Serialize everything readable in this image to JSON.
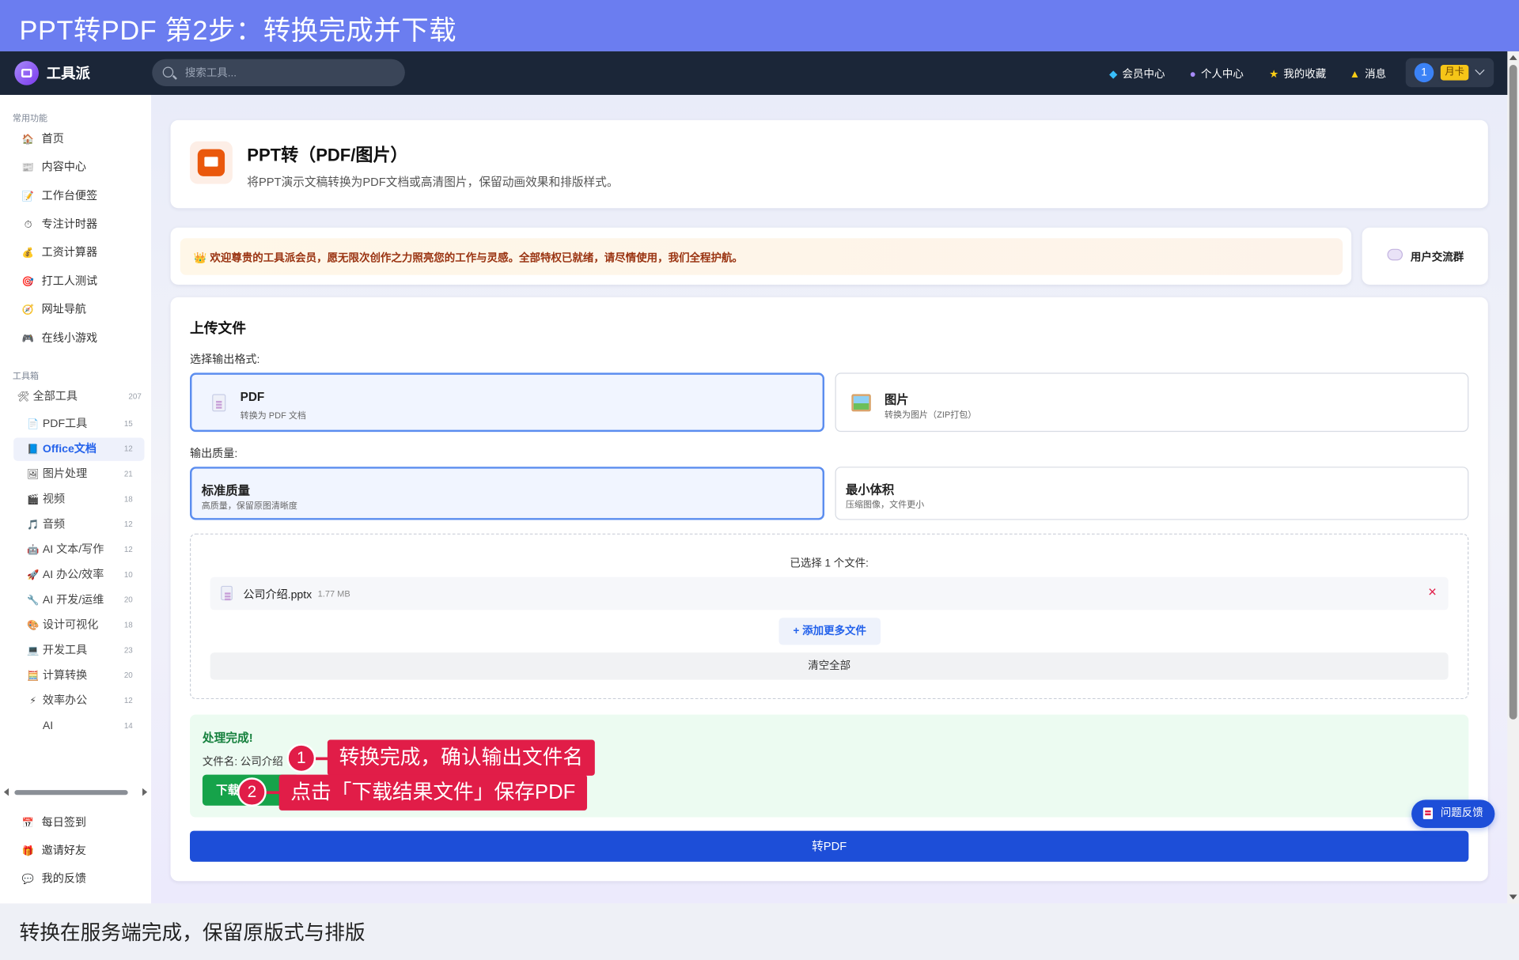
{
  "banner": {
    "title": "PPT转PDF 第2步：转换完成并下载"
  },
  "header": {
    "brand": "工具派",
    "search_placeholder": "搜索工具...",
    "nav": [
      {
        "label": "会员中心",
        "icon": "diamond-icon"
      },
      {
        "label": "个人中心",
        "icon": "user-icon"
      },
      {
        "label": "我的收藏",
        "icon": "star-icon"
      },
      {
        "label": "消息",
        "icon": "bell-icon"
      }
    ],
    "user": {
      "avatar": "1",
      "badge": "月卡"
    }
  },
  "sidebar": {
    "section_common": "常用功能",
    "common_items": [
      {
        "label": "首页",
        "icon": "home-icon",
        "glyph": "🏠"
      },
      {
        "label": "内容中心",
        "icon": "newspaper-icon",
        "glyph": "📰"
      },
      {
        "label": "工作台便签",
        "icon": "memo-icon",
        "glyph": "📝"
      },
      {
        "label": "专注计时器",
        "icon": "stopwatch-icon",
        "glyph": "⏱"
      },
      {
        "label": "工资计算器",
        "icon": "money-bag-icon",
        "glyph": "💰"
      },
      {
        "label": "打工人测试",
        "icon": "target-icon",
        "glyph": "🎯"
      },
      {
        "label": "网址导航",
        "icon": "compass-icon",
        "glyph": "🧭"
      },
      {
        "label": "在线小游戏",
        "icon": "gamepad-icon",
        "glyph": "🎮"
      }
    ],
    "section_tools": "工具箱",
    "all_tools": {
      "label": "全部工具",
      "count": "207",
      "glyph": "🛠"
    },
    "tool_items": [
      {
        "label": "PDF工具",
        "count": "15",
        "glyph": "📄"
      },
      {
        "label": "Office文档",
        "count": "12",
        "glyph": "📘",
        "active": true
      },
      {
        "label": "图片处理",
        "count": "21",
        "glyph": "🖼"
      },
      {
        "label": "视频",
        "count": "18",
        "glyph": "🎬"
      },
      {
        "label": "音频",
        "count": "12",
        "glyph": "🎵"
      },
      {
        "label": "AI 文本/写作",
        "count": "12",
        "glyph": "🤖"
      },
      {
        "label": "AI 办公/效率",
        "count": "10",
        "glyph": "🚀"
      },
      {
        "label": "AI 开发/运维",
        "count": "20",
        "glyph": "🔧"
      },
      {
        "label": "设计可视化",
        "count": "18",
        "glyph": "🎨"
      },
      {
        "label": "开发工具",
        "count": "23",
        "glyph": "💻"
      },
      {
        "label": "计算转换",
        "count": "20",
        "glyph": "🧮"
      },
      {
        "label": "效率办公",
        "count": "12",
        "glyph": "⚡"
      },
      {
        "label": "AI",
        "count": "14",
        "glyph": ""
      }
    ],
    "bottom_items": [
      {
        "label": "每日签到",
        "icon": "calendar-icon",
        "glyph": "📅"
      },
      {
        "label": "邀请好友",
        "icon": "gift-icon",
        "glyph": "🎁"
      },
      {
        "label": "我的反馈",
        "icon": "speech-bubble-icon",
        "glyph": "💬"
      }
    ]
  },
  "tool": {
    "title": "PPT转（PDF/图片）",
    "description": "将PPT演示文稿转换为PDF文档或高清图片，保留动画效果和排版样式。"
  },
  "welcome": {
    "text": "欢迎尊贵的工具派会员，愿无限次创作之力照亮您的工作与灵感。全部特权已就绪，请尽情使用，我们全程护航。",
    "glyph": "👑",
    "group_label": "用户交流群"
  },
  "upload": {
    "title": "上传文件",
    "format_label": "选择输出格式:",
    "formats": [
      {
        "title": "PDF",
        "desc": "转换为 PDF 文档",
        "selected": true
      },
      {
        "title": "图片",
        "desc": "转换为图片（ZIP打包）",
        "selected": false
      }
    ],
    "quality_label": "输出质量:",
    "qualities": [
      {
        "title": "标准质量",
        "desc": "高质量，保留原图清晰度",
        "selected": true
      },
      {
        "title": "最小体积",
        "desc": "压缩图像，文件更小",
        "selected": false
      }
    ],
    "selected_count": "已选择 1 个文件:",
    "file": {
      "name": "公司介绍.pptx",
      "size": "1.77 MB"
    },
    "remove_glyph": "×",
    "add_more": "+ 添加更多文件",
    "clear_all": "清空全部"
  },
  "result": {
    "title": "处理完成!",
    "filename_label": "文件名: 公司介绍",
    "download": "下载",
    "convert_button": "转PDF"
  },
  "feedback_button": "问题反馈",
  "callouts": [
    {
      "num": "1",
      "text": "转换完成，确认输出文件名"
    },
    {
      "num": "2",
      "text": "点击「下载结果文件」保存PDF"
    }
  ],
  "caption": "转换在服务端完成，保留原版式与排版",
  "colors": {
    "banner": "#6b7df0",
    "header": "#1b2638",
    "primary": "#1d4ed8",
    "accent": "#e11d48",
    "success": "#16a34a"
  }
}
